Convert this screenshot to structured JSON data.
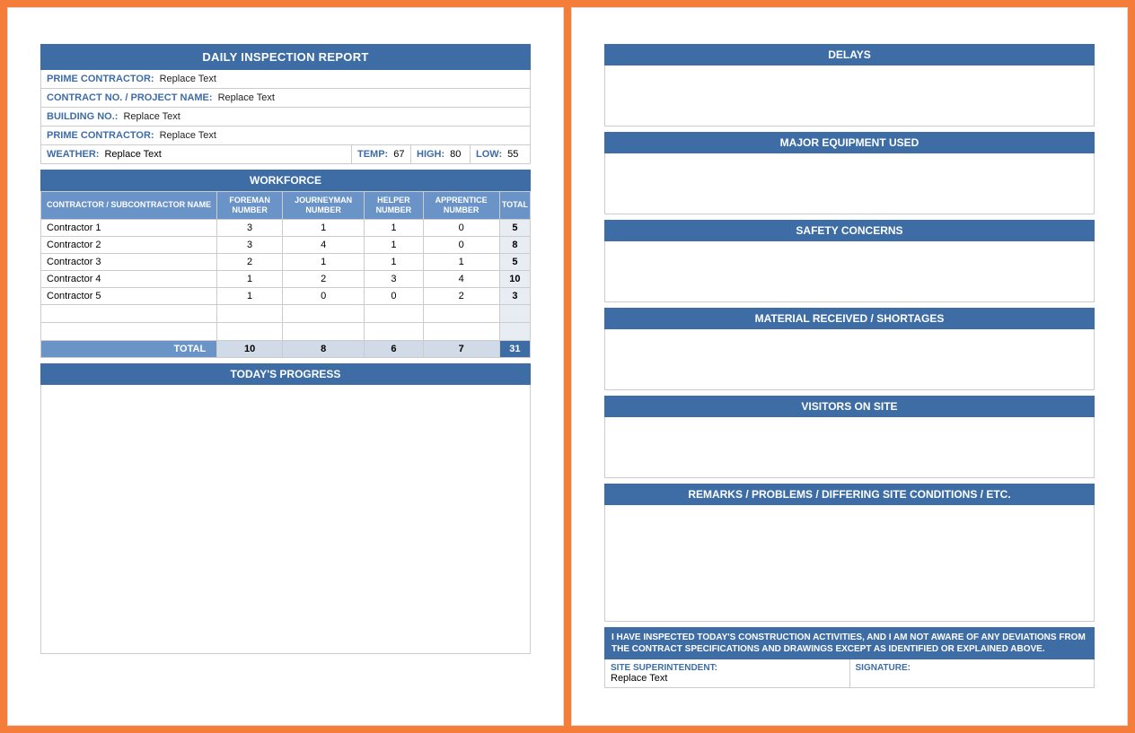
{
  "report": {
    "title": "DAILY INSPECTION REPORT",
    "fields": {
      "prime_contractor_label": "PRIME CONTRACTOR:",
      "prime_contractor_value": "Replace Text",
      "contract_label": "CONTRACT NO. / PROJECT NAME:",
      "contract_value": "Replace Text",
      "building_label": "BUILDING NO.:",
      "building_value": "Replace Text",
      "prime_contractor2_label": "PRIME CONTRACTOR:",
      "prime_contractor2_value": "Replace Text",
      "weather_label": "WEATHER:",
      "weather_value": "Replace Text",
      "temp_label": "TEMP:",
      "temp_value": "67",
      "high_label": "HIGH:",
      "high_value": "80",
      "low_label": "LOW:",
      "low_value": "55"
    },
    "workforce_title": "WORKFORCE",
    "workforce_headers": {
      "name": "CONTRACTOR / SUBCONTRACTOR NAME",
      "foreman": "FOREMAN NUMBER",
      "journeyman": "JOURNEYMAN NUMBER",
      "helper": "HELPER NUMBER",
      "apprentice": "APPRENTICE NUMBER",
      "total": "TOTAL"
    },
    "workforce_rows": [
      {
        "name": "Contractor 1",
        "foreman": "3",
        "journeyman": "1",
        "helper": "1",
        "apprentice": "0",
        "total": "5"
      },
      {
        "name": "Contractor 2",
        "foreman": "3",
        "journeyman": "4",
        "helper": "1",
        "apprentice": "0",
        "total": "8"
      },
      {
        "name": "Contractor 3",
        "foreman": "2",
        "journeyman": "1",
        "helper": "1",
        "apprentice": "1",
        "total": "5"
      },
      {
        "name": "Contractor 4",
        "foreman": "1",
        "journeyman": "2",
        "helper": "3",
        "apprentice": "4",
        "total": "10"
      },
      {
        "name": "Contractor 5",
        "foreman": "1",
        "journeyman": "0",
        "helper": "0",
        "apprentice": "2",
        "total": "3"
      }
    ],
    "workforce_total_label": "TOTAL",
    "workforce_totals": {
      "foreman": "10",
      "journeyman": "8",
      "helper": "6",
      "apprentice": "7",
      "total": "31"
    },
    "progress_title": "TODAY'S PROGRESS"
  },
  "right": {
    "delays": "DELAYS",
    "equipment": "MAJOR EQUIPMENT USED",
    "safety": "SAFETY CONCERNS",
    "material": "MATERIAL RECEIVED / SHORTAGES",
    "visitors": "VISITORS ON SITE",
    "remarks": "REMARKS / PROBLEMS / DIFFERING SITE CONDITIONS / ETC.",
    "cert": "I HAVE INSPECTED TODAY'S CONSTRUCTION ACTIVITIES, AND I AM NOT AWARE OF ANY DEVIATIONS FROM THE CONTRACT SPECIFICATIONS AND DRAWINGS EXCEPT AS IDENTIFIED OR EXPLAINED ABOVE.",
    "super_label": "SITE SUPERINTENDENT:",
    "super_value": "Replace Text",
    "sig_label": "SIGNATURE:"
  }
}
